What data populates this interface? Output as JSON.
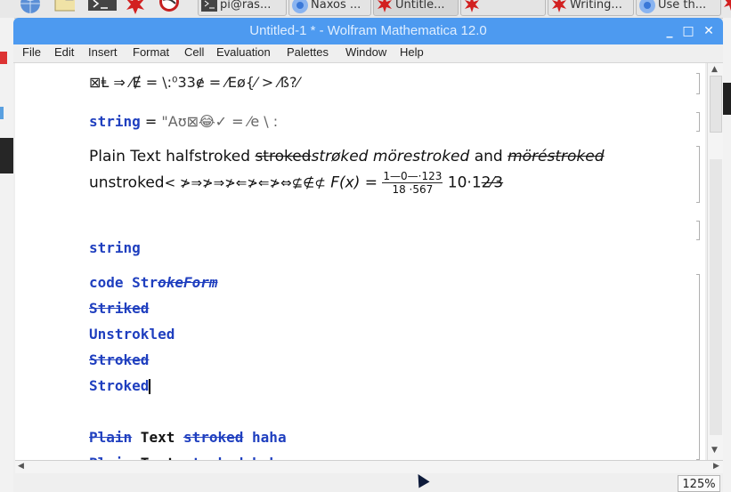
{
  "taskbar": {
    "launchers": [
      "globe-icon",
      "folder-icon",
      "terminal-icon",
      "mathematica-icon",
      "wolfram-icon"
    ],
    "tasks": [
      {
        "label": "pi@ras...",
        "icon": "terminal-icon",
        "active": false
      },
      {
        "label": "Naxos ...",
        "icon": "chromium-icon",
        "active": false
      },
      {
        "label": "Untitle...",
        "icon": "mathematica-icon",
        "active": true
      },
      {
        "label": "",
        "icon": "mathematica-icon",
        "active": false
      },
      {
        "label": "Writing...",
        "icon": "mathematica-icon",
        "active": false
      },
      {
        "label": "Use th...",
        "icon": "chromium-icon",
        "active": false
      }
    ]
  },
  "window": {
    "title": "Untitled-1 * - Wolfram Mathematica 12.0",
    "controls": [
      "minimize",
      "maximize",
      "close"
    ]
  },
  "menu": [
    {
      "label": "File",
      "mnemonic": "F"
    },
    {
      "label": "Edit",
      "mnemonic": "E"
    },
    {
      "label": "Insert",
      "mnemonic": "I"
    },
    {
      "label": "Format",
      "mnemonic": "r"
    },
    {
      "label": "Cell",
      "mnemonic": "C"
    },
    {
      "label": "Evaluation",
      "mnemonic": "v"
    },
    {
      "label": "Palettes",
      "mnemonic": "P"
    },
    {
      "label": "Window",
      "mnemonic": "W"
    },
    {
      "label": "Help",
      "mnemonic": "H"
    }
  ],
  "cells": {
    "c1": "⊠Ⱡ ⇒ ⁄Ɇ = \\:⁰33ɇ = ⁄Eø{⁄ > ⁄ß?⁄",
    "c2": {
      "name": "string",
      "eq": "=",
      "str": "\"Aʊ⊠😂✓ = ⁄e \\ :"
    },
    "c3a": {
      "p1": "Plain Text ",
      "p2": "halfstroked",
      "p3": " ",
      "p4": "stroked",
      "p5": "strøked",
      "p6": " mörestroked",
      "p7": " and ",
      "p8": "möréstroked"
    },
    "c3b": {
      "u": "unstroked",
      "arrows": "< ≯⇒≯⇒≯⇐≯⇐≯⇔⊈∉⊄",
      "fx": "F(x) = ",
      "num": "1—0—·123",
      "den": "18 ·567",
      "tail": "10·1",
      "tail2": "2⁄3"
    },
    "c4": "string",
    "c5": {
      "a": "code ",
      "b": "Str",
      "c": "okeForm"
    },
    "c6": "Striked",
    "c7": "Unstrokled",
    "c8": "Stroked",
    "c9": "Stroked",
    "c10": {
      "a": "Plain",
      "b": " Text ",
      "c": "stroked",
      "d": " haha"
    },
    "c11": {
      "a": "Plain",
      "b": " Text ",
      "c": "stroked",
      "d": " haha"
    }
  },
  "status": {
    "zoom": "125%"
  }
}
